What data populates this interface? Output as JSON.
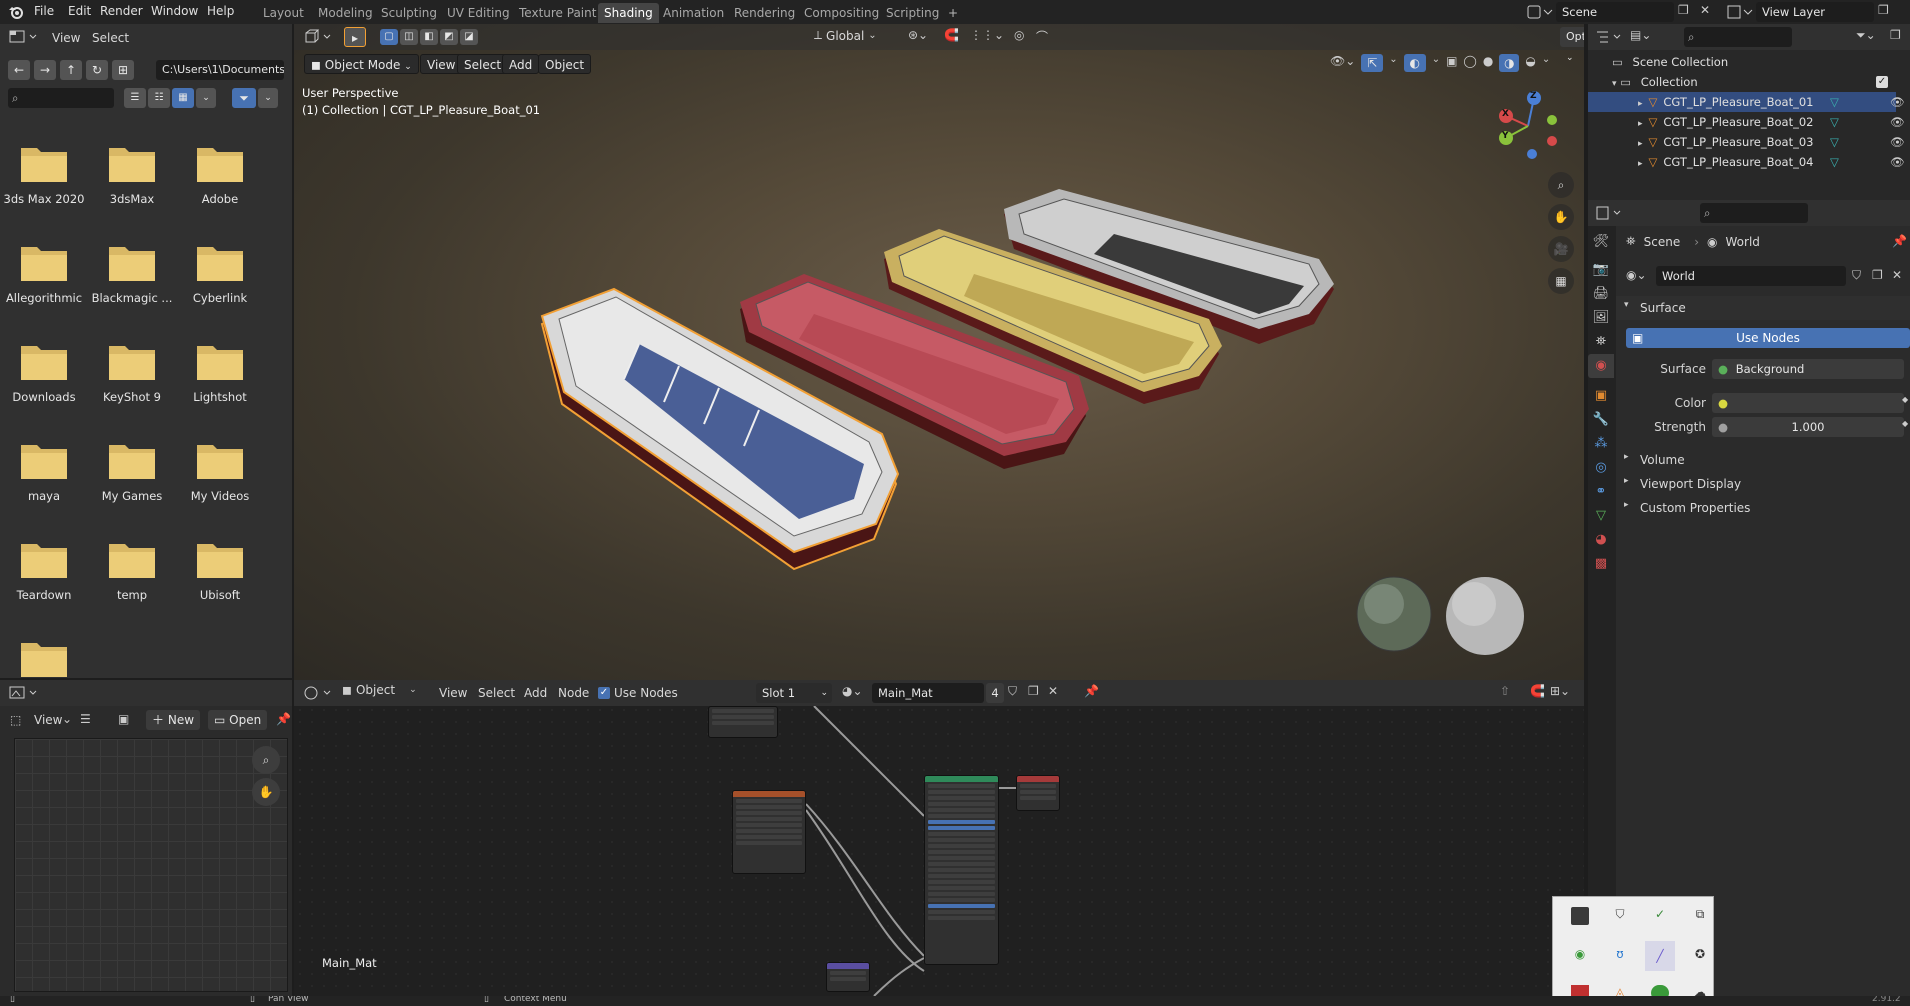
{
  "topbar": {
    "menus": [
      "File",
      "Edit",
      "Render",
      "Window",
      "Help"
    ],
    "workspaces": [
      "Layout",
      "Modeling",
      "Sculpting",
      "UV Editing",
      "Texture Paint",
      "Shading",
      "Animation",
      "Rendering",
      "Compositing",
      "Scripting"
    ],
    "active_workspace": "Shading",
    "add_tab": "+",
    "scene_name": "Scene",
    "view_layer": "View Layer"
  },
  "file_browser": {
    "menus": [
      "View",
      "Select"
    ],
    "path": "C:\\Users\\1\\Documents\\",
    "folders": [
      {
        "label": "3ds Max 2020"
      },
      {
        "label": "3dsMax"
      },
      {
        "label": "Adobe"
      },
      {
        "label": "Allegorithmic"
      },
      {
        "label": "Blackmagic ..."
      },
      {
        "label": "Cyberlink"
      },
      {
        "label": "Downloads"
      },
      {
        "label": "KeyShot 9"
      },
      {
        "label": "Lightshot"
      },
      {
        "label": "maya"
      },
      {
        "label": "My Games"
      },
      {
        "label": "My Videos"
      },
      {
        "label": "Teardown"
      },
      {
        "label": "temp"
      },
      {
        "label": "Ubisoft"
      },
      {
        "label": ""
      }
    ]
  },
  "image_editor": {
    "view_label": "View",
    "new_label": "New",
    "open_label": "Open"
  },
  "viewport": {
    "mode": "Object Mode",
    "menus": [
      "View",
      "Select",
      "Add",
      "Object"
    ],
    "orientation": "Global",
    "options": "Options",
    "perspective_label": "User Perspective",
    "collection_label": "(1) Collection | CGT_LP_Pleasure_Boat_01",
    "gizmo": {
      "x": "X",
      "y": "Y",
      "z": "Z"
    }
  },
  "node_editor": {
    "object_label": "Object",
    "menus": [
      "View",
      "Select",
      "Add",
      "Node"
    ],
    "use_nodes": "Use Nodes",
    "slot": "Slot 1",
    "material": "Main_Mat",
    "users": "4",
    "material_label": "Main_Mat"
  },
  "outliner": {
    "scene_collection": "Scene Collection",
    "collection": "Collection",
    "items": [
      {
        "label": "CGT_LP_Pleasure_Boat_01",
        "selected": true
      },
      {
        "label": "CGT_LP_Pleasure_Boat_02",
        "selected": false
      },
      {
        "label": "CGT_LP_Pleasure_Boat_03",
        "selected": false
      },
      {
        "label": "CGT_LP_Pleasure_Boat_04",
        "selected": false
      }
    ]
  },
  "properties": {
    "breadcrumb_scene": "Scene",
    "breadcrumb_world": "World",
    "world_name": "World",
    "surface_header": "Surface",
    "use_nodes_button": "Use Nodes",
    "surface_label": "Surface",
    "surface_value": "Background",
    "color_label": "Color",
    "strength_label": "Strength",
    "strength_value": "1.000",
    "sections": [
      "Volume",
      "Viewport Display",
      "Custom Properties"
    ]
  },
  "statusbar": {
    "pan_view": "Pan View",
    "context_menu": "Context Menu",
    "version": "2.91.2"
  },
  "colors": {
    "accent_blue": "#4772b3",
    "selection_orange": "#f2a035",
    "header_bg": "#303030",
    "panel_bg": "#2b2b2b"
  }
}
